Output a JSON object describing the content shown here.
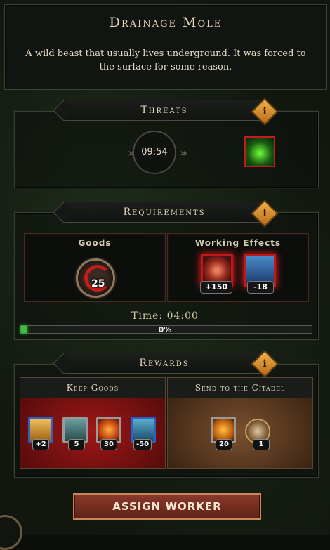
{
  "header": {
    "title": "Drainage Mole",
    "description": "A wild beast that usually lives underground. It was forced to the surface for some reason."
  },
  "threats": {
    "label": "Threats",
    "timer": "09:54",
    "info_icon": "i",
    "threat_icon": "green-plague-icon"
  },
  "requirements": {
    "label": "Requirements",
    "info_icon": "i",
    "goods": {
      "label": "Goods",
      "value": "25",
      "icon": "grain-sack-icon"
    },
    "working_effects": {
      "label": "Working Effects",
      "items": [
        {
          "icon": "dragon-eye-icon",
          "value": "+150"
        },
        {
          "icon": "hooded-figure-icon",
          "value": "-18"
        }
      ]
    },
    "time_label": "Time: 04:00",
    "progress_text": "0%",
    "progress_fraction": 0.02
  },
  "rewards": {
    "label": "Rewards",
    "info_icon": "i",
    "keep_goods": {
      "label": "Keep Goods",
      "items": [
        {
          "icon": "gold-bread-icon",
          "value": "+2"
        },
        {
          "icon": "stone-tablet-icon",
          "value": "5"
        },
        {
          "icon": "fire-resource-icon",
          "value": "30"
        },
        {
          "icon": "blue-crate-icon",
          "value": "-50"
        }
      ]
    },
    "send_to_citadel": {
      "label": "Send to the Citadel",
      "items": [
        {
          "icon": "amber-resource-icon",
          "value": "20"
        },
        {
          "icon": "citadel-emblem-icon",
          "value": "1"
        }
      ]
    }
  },
  "actions": {
    "assign_worker": "ASSIGN WORKER"
  },
  "colors": {
    "accent_gold": "#d9a040",
    "danger_red": "#c21c1c",
    "progress_green": "#3fbf3f",
    "keep_panel_red": "#8a1414",
    "citadel_panel_brown": "#5a3a22"
  }
}
